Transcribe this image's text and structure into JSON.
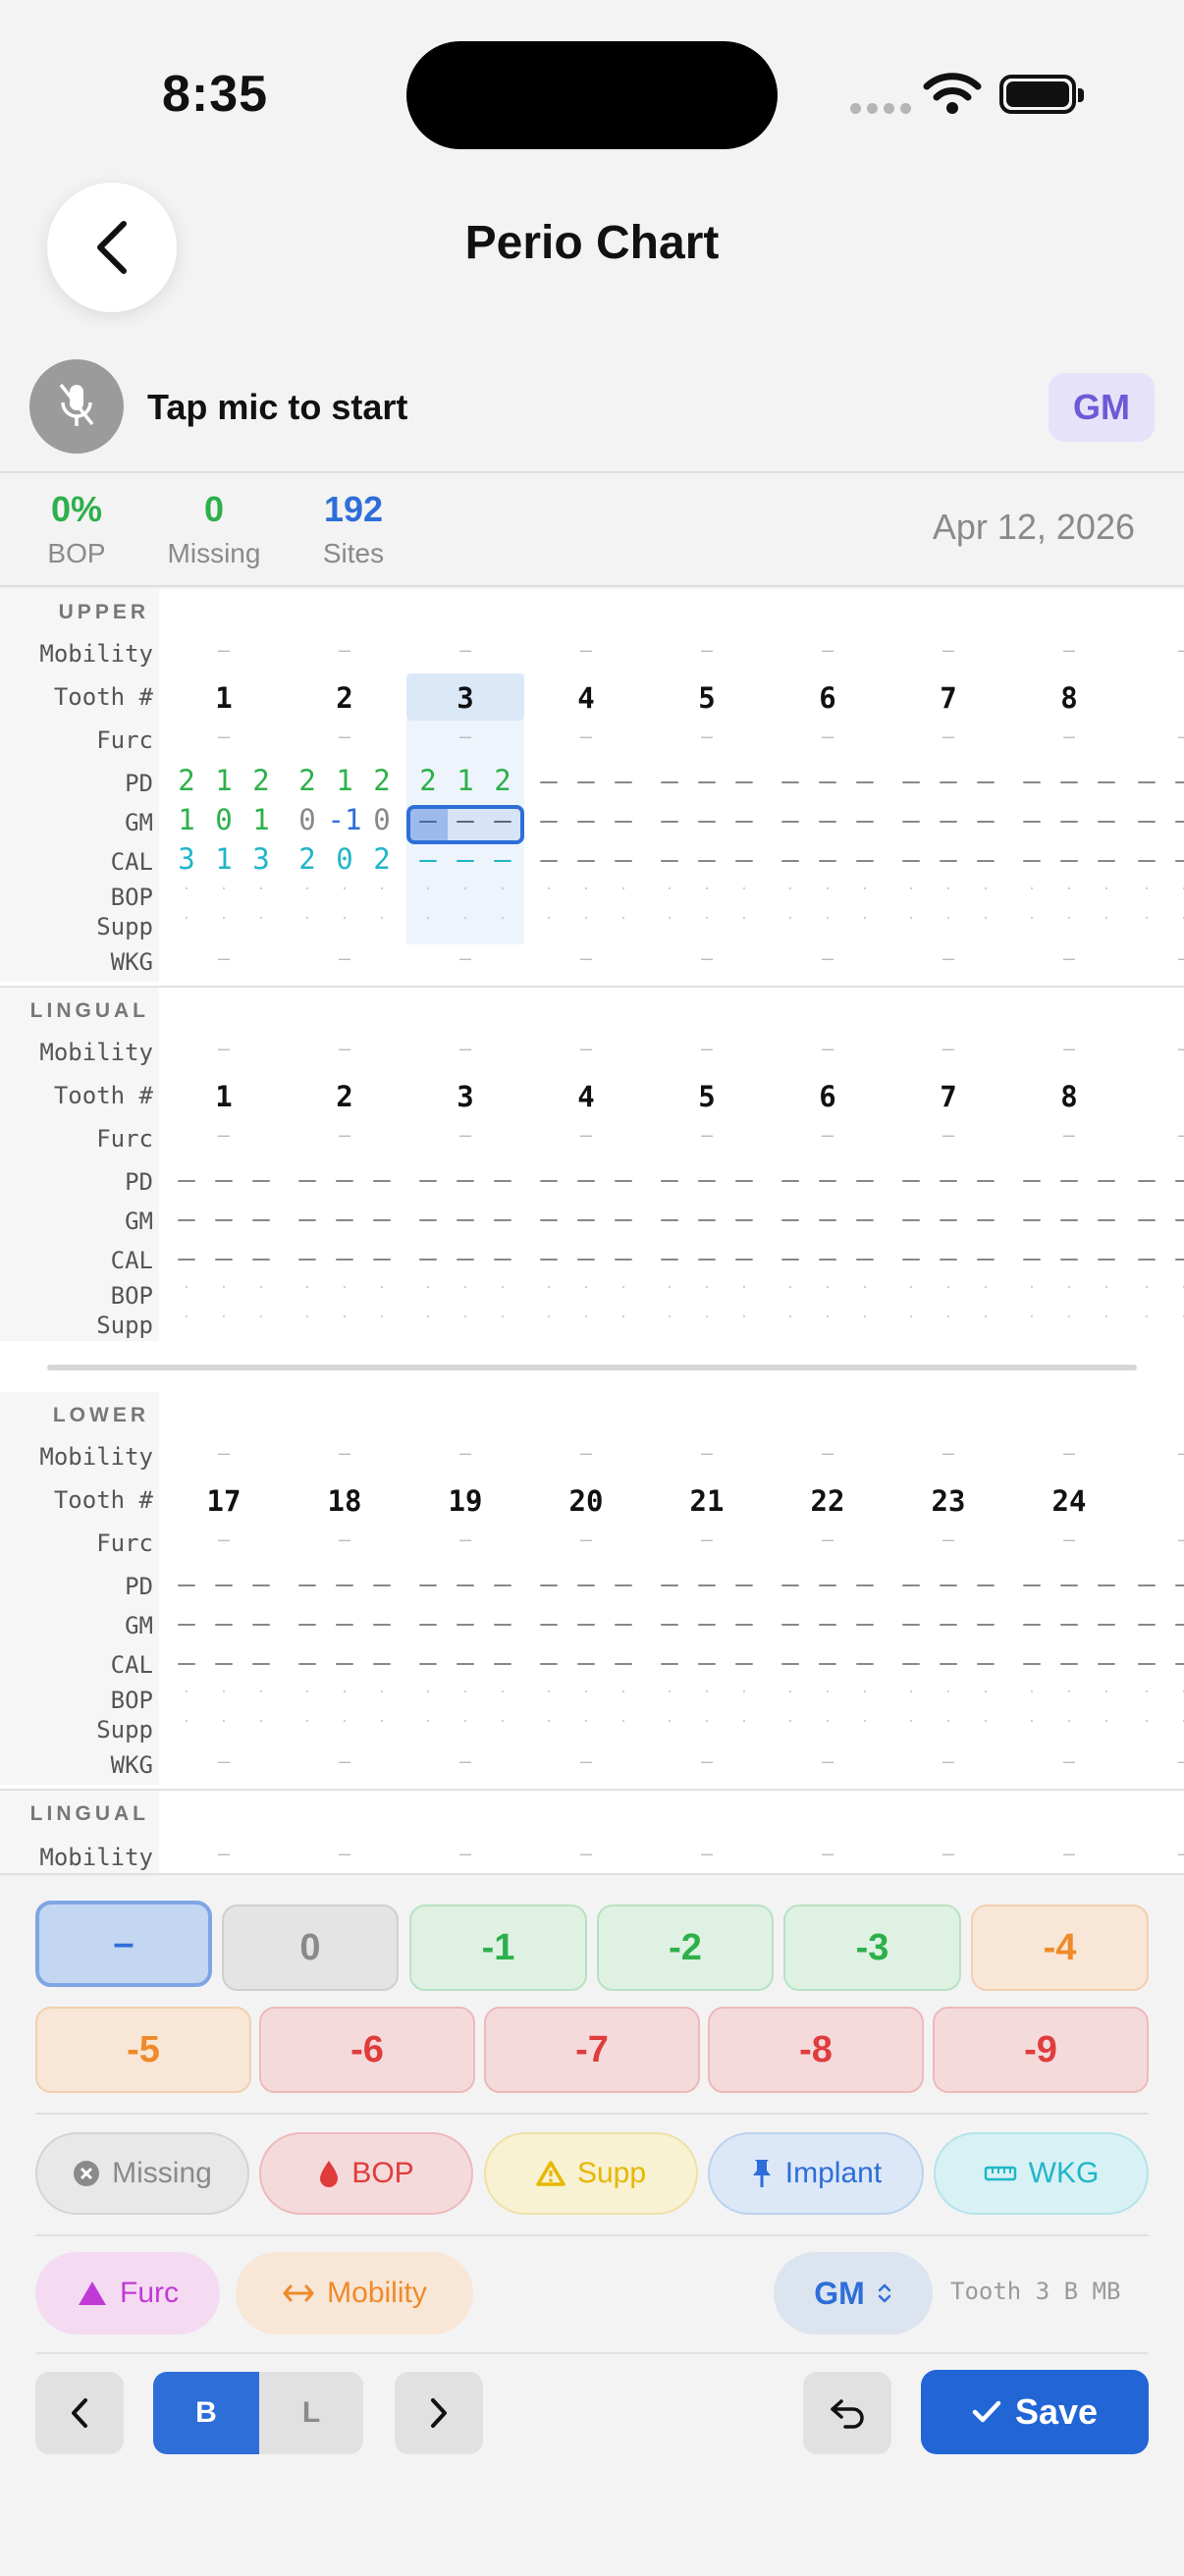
{
  "status": {
    "time": "8:35"
  },
  "header": {
    "title": "Perio Chart"
  },
  "mic": {
    "label": "Tap mic to start",
    "mode_badge": "GM"
  },
  "stats": [
    {
      "value": "0%",
      "label": "BOP",
      "color": "#2db04b"
    },
    {
      "value": "0",
      "label": "Missing",
      "color": "#2db04b"
    },
    {
      "value": "192",
      "label": "Sites",
      "color": "#2e6ed8"
    }
  ],
  "date": "Apr 12, 2026",
  "chart": {
    "sections": {
      "upper": "UPPER",
      "lingual": "LINGUAL",
      "lower": "LOWER"
    },
    "row_labels": {
      "mobility": "Mobility",
      "tooth": "Tooth #",
      "furc": "Furc",
      "pd": "PD",
      "gm": "GM",
      "cal": "CAL",
      "bop": "BOP",
      "supp": "Supp",
      "wkg": "WKG"
    },
    "upper_teeth": [
      "1",
      "2",
      "3",
      "4",
      "5",
      "6",
      "7",
      "8"
    ],
    "lower_teeth": [
      "17",
      "18",
      "19",
      "20",
      "21",
      "22",
      "23",
      "24"
    ],
    "selected_tooth": "3",
    "upper_buccal": {
      "pd": [
        [
          "2",
          "1",
          "2"
        ],
        [
          "2",
          "1",
          "2"
        ],
        [
          "2",
          "1",
          "2"
        ]
      ],
      "gm": [
        [
          "1",
          "0",
          "1"
        ],
        [
          "0",
          "-1",
          "0"
        ],
        [
          "–",
          "–",
          "–"
        ]
      ],
      "cal": [
        [
          "3",
          "1",
          "3"
        ],
        [
          "2",
          "0",
          "2"
        ],
        [
          "–",
          "–",
          "–"
        ]
      ]
    },
    "empty": "–",
    "dot": "·"
  },
  "keypad": {
    "row1": [
      "–",
      "0",
      "-1",
      "-2",
      "-3",
      "-4"
    ],
    "row2": [
      "-5",
      "-6",
      "-7",
      "-8",
      "-9"
    ]
  },
  "chips": {
    "missing": "Missing",
    "bop": "BOP",
    "supp": "Supp",
    "implant": "Implant",
    "wkg": "WKG",
    "furc": "Furc",
    "mobility": "Mobility"
  },
  "field_selector": {
    "value": "GM",
    "context": "Tooth 3 B MB"
  },
  "nav": {
    "buccal": "B",
    "lingual": "L",
    "save": "Save"
  },
  "colors": {
    "green": "#2db04b",
    "cyan": "#1fb6c9",
    "blue": "#2e6ed8",
    "orange": "#ef8a2a",
    "red": "#e03c3c",
    "purple": "#c23ad6",
    "yellow": "#e6b800"
  }
}
